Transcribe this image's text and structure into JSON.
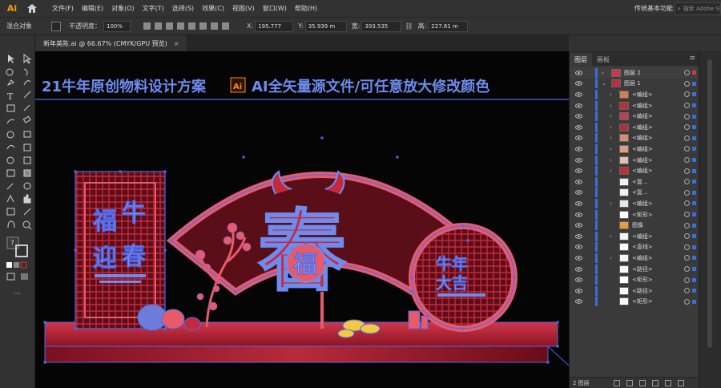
{
  "app": {
    "logo": "Ai",
    "workspace": "传统基本功能",
    "search_placeholder": "搜索 Adobe Stock"
  },
  "menu": [
    {
      "label": "文件(F)"
    },
    {
      "label": "编辑(E)"
    },
    {
      "label": "对象(O)"
    },
    {
      "label": "文字(T)"
    },
    {
      "label": "选择(S)"
    },
    {
      "label": "效果(C)"
    },
    {
      "label": "视图(V)"
    },
    {
      "label": "窗口(W)"
    },
    {
      "label": "帮助(H)"
    }
  ],
  "control": {
    "selection_label": "混合对象",
    "opacity_label": "不透明度：",
    "opacity_value": "100%",
    "x_label": "X:",
    "x_value": "195.777",
    "y_label": "Y:",
    "y_value": "35.939 m",
    "w_label": "宽:",
    "w_value": "393.535",
    "h_label": "高:",
    "h_value": "227.61 m"
  },
  "document": {
    "tab_title": "新年美陈.ai @ 66.67% (CMYK/GPU 预览)",
    "close": "×"
  },
  "artboard": {
    "header_left": "21牛年原创物料设计方案",
    "header_badge": "Ai",
    "header_right": "AI全矢量源文件/可任意放大修改颜色",
    "left_panel_chars": [
      "福",
      "牛",
      "迎",
      "春"
    ],
    "center_char": "春",
    "center_medallion": "福",
    "right_panel_lines": [
      "牛年",
      "大吉"
    ]
  },
  "layers_panel": {
    "tabs": [
      {
        "label": "图层"
      },
      {
        "label": "画板"
      }
    ],
    "menu_icon": "≡",
    "rows": [
      {
        "name": "图层 2",
        "twisty": "›",
        "thumb": "#c73a4a",
        "top": true
      },
      {
        "name": "图层 1",
        "twisty": "⌄",
        "thumb": "#b83040"
      },
      {
        "name": "<编组>",
        "twisty": "›",
        "thumb": "#d08050"
      },
      {
        "name": "<编组>",
        "twisty": "›",
        "thumb": "#b83030"
      },
      {
        "name": "<编组>",
        "twisty": "›",
        "thumb": "#c04050"
      },
      {
        "name": "<编组>",
        "twisty": "›",
        "thumb": "#a83040"
      },
      {
        "name": "<编组>",
        "twisty": "›",
        "thumb": "#d09070"
      },
      {
        "name": "<编组>",
        "twisty": "›",
        "thumb": "#d8a080"
      },
      {
        "name": "<编组>",
        "twisty": "›",
        "thumb": "#e0c0b0"
      },
      {
        "name": "<编组>",
        "twisty": "›",
        "thumb": "#c03030"
      },
      {
        "name": "<复...",
        "twisty": "",
        "thumb": "#f0f0f0"
      },
      {
        "name": "<复...",
        "twisty": "",
        "thumb": "#f0f0f0"
      },
      {
        "name": "<编组>",
        "twisty": "›",
        "thumb": "#e8e8e8"
      },
      {
        "name": "<矩形>",
        "twisty": "",
        "thumb": "#ffffff"
      },
      {
        "name": "图像",
        "twisty": "",
        "thumb": "#e0a040"
      },
      {
        "name": "<编组>",
        "twisty": "›",
        "thumb": "#f4f4f4"
      },
      {
        "name": "<直线>",
        "twisty": "",
        "thumb": "#ffffff"
      },
      {
        "name": "<编组>",
        "twisty": "›",
        "thumb": "#f4f4f4"
      },
      {
        "name": "<路径>",
        "twisty": "",
        "thumb": "#ffffff"
      },
      {
        "name": "<矩形>",
        "twisty": "",
        "thumb": "#ffffff"
      },
      {
        "name": "<路径>",
        "twisty": "",
        "thumb": "#ffffff"
      },
      {
        "name": "<矩形>",
        "twisty": "",
        "thumb": "#ffffff"
      }
    ],
    "footer_label": "2 图层"
  },
  "colors": {
    "selection_blue": "#4a6cf0",
    "artwork_red": "#c8283c",
    "artwork_pink": "#e85a6a"
  }
}
